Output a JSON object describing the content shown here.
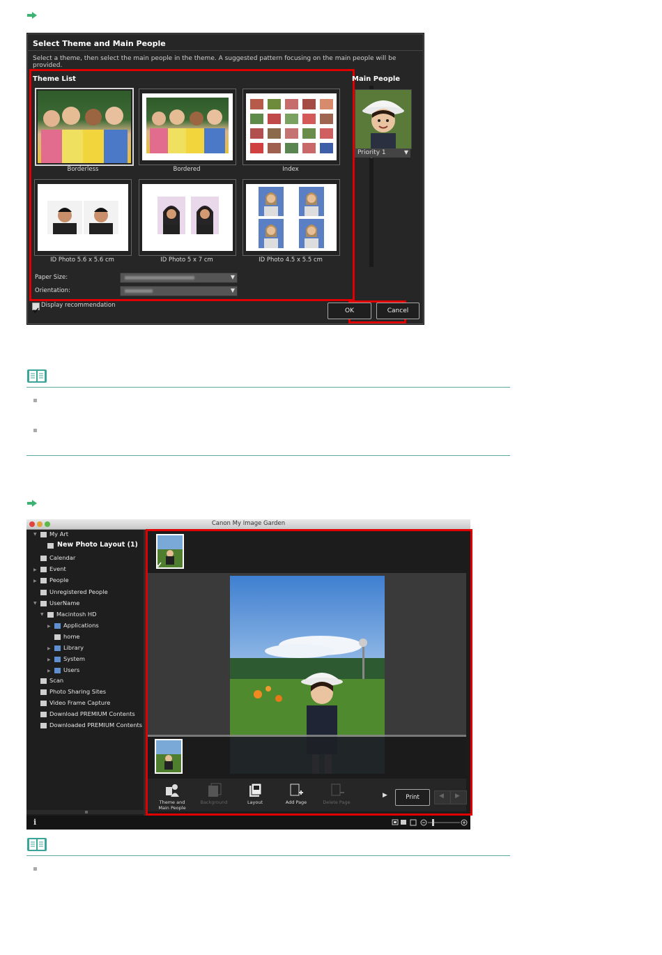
{
  "dialog": {
    "title": "Select Theme and Main People",
    "subtitle": "Select a theme, then select the main people in the theme. A suggested pattern focusing on the main people will be provided.",
    "theme_list_label": "Theme List",
    "main_people_label": "Main People",
    "themes": [
      {
        "label": "Borderless"
      },
      {
        "label": "Bordered"
      },
      {
        "label": "Index"
      },
      {
        "label": "ID Photo 5.6 x 5.6 cm"
      },
      {
        "label": "ID Photo 5 x 7 cm"
      },
      {
        "label": "ID Photo 4.5 x 5.5 cm"
      }
    ],
    "priority_label": "Priority 1",
    "paper_size_label": "Paper Size:",
    "orientation_label": "Orientation:",
    "display_recommendation_label": "Display recommendation",
    "display_recommendation_checked": true,
    "ok_label": "OK",
    "cancel_label": "Cancel",
    "highlight_color": "#e00000"
  },
  "app": {
    "window_title": "Canon My Image Garden",
    "sidebar": {
      "items": [
        {
          "label": "My Art"
        },
        {
          "label": "New Photo Layout (1)"
        },
        {
          "label": "Calendar"
        },
        {
          "label": "Event"
        },
        {
          "label": "People"
        },
        {
          "label": "Unregistered People"
        },
        {
          "label": "UserName"
        },
        {
          "label": "Macintosh HD"
        },
        {
          "label": "Applications"
        },
        {
          "label": "home"
        },
        {
          "label": "Library"
        },
        {
          "label": "System"
        },
        {
          "label": "Users"
        },
        {
          "label": "Scan"
        },
        {
          "label": "Photo Sharing Sites"
        },
        {
          "label": "Video Frame Capture"
        },
        {
          "label": "Download PREMIUM Contents"
        },
        {
          "label": "Downloaded PREMIUM Contents"
        }
      ]
    },
    "toolbar": {
      "theme_label": "Theme and Main People",
      "background_label": "Background",
      "layout_label": "Layout",
      "add_page_label": "Add Page",
      "delete_page_label": "Delete Page",
      "print_label": "Print"
    },
    "status": {
      "info_label": "i"
    }
  },
  "colors": {
    "accent_red": "#e00000",
    "note_teal": "#5aa8a0",
    "arrow_green": "#3cb371"
  },
  "icons": {
    "step_arrow": "arrow-right-icon",
    "note": "book-icon"
  }
}
